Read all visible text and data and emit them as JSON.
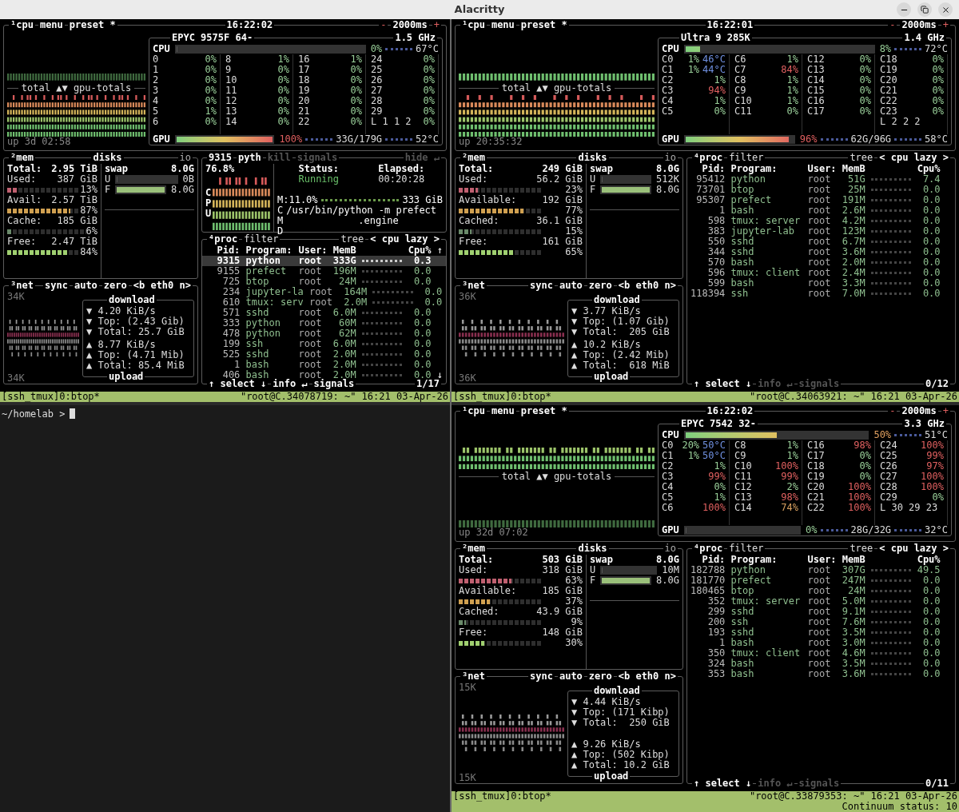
{
  "window": {
    "title": "Alacritty"
  },
  "panes": [
    {
      "cpu": {
        "tabs": [
          "¹cpu",
          "menu",
          "preset *"
        ],
        "time": "16:22:02",
        "minus": "-",
        "interval": "2000ms",
        "plus": "+",
        "model": "EPYC 9575F 64-",
        "freq": "1.5 GHz",
        "label": "CPU",
        "pct": "0%",
        "level": 0,
        "temp": "67°C",
        "graph_label": "total ▲▼ gpu-totals",
        "uptime": "up 3d 02:58",
        "gpu": {
          "label": "GPU",
          "pct": "100%",
          "level": 1,
          "mem": "33G/179G",
          "temp": "52°C"
        },
        "core_columns": [
          [
            {
              "label": "0",
              "pct": "0%",
              "color": "#9ad09a"
            },
            {
              "label": "1",
              "pct": "0%",
              "color": "#9ad09a"
            },
            {
              "label": "2",
              "pct": "0%",
              "color": "#9ad09a"
            },
            {
              "label": "3",
              "pct": "0%",
              "color": "#9ad09a"
            },
            {
              "label": "4",
              "pct": "0%",
              "color": "#9ad09a"
            },
            {
              "label": "5",
              "pct": "1%",
              "color": "#9ad09a"
            },
            {
              "label": "6",
              "pct": "0%",
              "color": "#9ad09a"
            }
          ],
          [
            {
              "label": "8",
              "pct": "1%",
              "color": "#9ad09a"
            },
            {
              "label": "9",
              "pct": "0%",
              "color": "#9ad09a"
            },
            {
              "label": "10",
              "pct": "0%",
              "color": "#9ad09a"
            },
            {
              "label": "11",
              "pct": "0%",
              "color": "#9ad09a"
            },
            {
              "label": "12",
              "pct": "0%",
              "color": "#9ad09a"
            },
            {
              "label": "13",
              "pct": "0%",
              "color": "#9ad09a"
            },
            {
              "label": "14",
              "pct": "0%",
              "color": "#9ad09a"
            }
          ],
          [
            {
              "label": "16",
              "pct": "1%",
              "color": "#9ad09a"
            },
            {
              "label": "17",
              "pct": "0%",
              "color": "#9ad09a"
            },
            {
              "label": "18",
              "pct": "0%",
              "color": "#9ad09a"
            },
            {
              "label": "19",
              "pct": "0%",
              "color": "#9ad09a"
            },
            {
              "label": "20",
              "pct": "0%",
              "color": "#9ad09a"
            },
            {
              "label": "21",
              "pct": "0%",
              "color": "#9ad09a"
            },
            {
              "label": "22",
              "pct": "0%",
              "color": "#9ad09a"
            }
          ],
          [
            {
              "label": "24",
              "pct": "0%",
              "color": "#9ad09a"
            },
            {
              "label": "25",
              "pct": "0%",
              "color": "#9ad09a"
            },
            {
              "label": "26",
              "pct": "0%",
              "color": "#9ad09a"
            },
            {
              "label": "27",
              "pct": "0%",
              "color": "#9ad09a"
            },
            {
              "label": "28",
              "pct": "0%",
              "color": "#9ad09a"
            },
            {
              "label": "29",
              "pct": "0%",
              "color": "#9ad09a"
            },
            {
              "label": "L 1 1 2",
              "pct": "0%",
              "color": "#9ad09a"
            }
          ]
        ]
      },
      "mem": {
        "title": "²mem",
        "total_label": "Total:",
        "total": "2.95 TiB",
        "rows": [
          {
            "kind": "used",
            "label": "Used:",
            "value": "387 GiB",
            "pct": "13%",
            "level": 0.13
          },
          {
            "kind": "available",
            "label": "Avail:",
            "value": "2.57 TiB",
            "pct": "87%",
            "level": 0.87
          },
          {
            "kind": "cached",
            "label": "Cache:",
            "value": "185 GiB",
            "pct": "6%",
            "level": 0.06
          },
          {
            "kind": "free",
            "label": "Free:",
            "value": "2.47 TiB",
            "pct": "84%",
            "level": 0.84
          }
        ],
        "disks": {
          "title": "disks",
          "io": "io",
          "swap_label": "swap",
          "swap": "8.0G",
          "bars": [
            {
              "label": "U",
              "value": "0B",
              "level": 0
            },
            {
              "label": "F",
              "value": "8.0G",
              "level": 1
            }
          ]
        }
      },
      "net": {
        "title": "³net",
        "buttons": [
          "sync",
          "auto",
          "zero",
          "<b eth0 n>"
        ],
        "scale_top": "34K",
        "scale_bottom": "34K",
        "download_label": "download",
        "upload_label": "upload",
        "download": [
          "▼ 4.20 KiB/s",
          "▼ Top: (2.43 Gib)",
          "▼ Total: 25.7 GiB"
        ],
        "upload": [
          "▲ 8.77 KiB/s",
          "▲ Top: (4.71 Mib)",
          "▲ Total: 85.4 MiB"
        ]
      },
      "detail": {
        "pid": "9315",
        "name": "pyth",
        "buttons": [
          "kill",
          "signals"
        ],
        "hide": "hide ↵",
        "cpu_pct": "76.8%",
        "cpu_letters": "CPU",
        "status_label": "Status:",
        "status": "Running",
        "elapsed_label": "Elapsed:",
        "elapsed": "00:20:28",
        "mem_pct": "M:11.0%",
        "mem": "333 GiB",
        "cmd_letters": "CMD",
        "cmd": "/usr/bin/python -m prefect",
        "cmd2": ".engine"
      },
      "proc": {
        "title": "⁴proc",
        "filter": "filter",
        "tree": "tree",
        "sort": "< cpu lazy >",
        "columns": [
          "Pid:",
          "Program:",
          "User:",
          "MemB",
          "Cpu%"
        ],
        "scroll_up": "↑",
        "scroll_down": "↓",
        "rows": [
          {
            "pid": "9315",
            "program": "python",
            "user": "root",
            "mem": "333G",
            "cpu": "0.3",
            "selected": true
          },
          {
            "pid": "9155",
            "program": "prefect",
            "user": "root",
            "mem": "196M",
            "cpu": "0.0",
            "selected": false
          },
          {
            "pid": "725",
            "program": "btop",
            "user": "root",
            "mem": "24M",
            "cpu": "0.0",
            "selected": false
          },
          {
            "pid": "234",
            "program": "jupyter-la",
            "user": "root",
            "mem": "164M",
            "cpu": "0.0",
            "selected": false
          },
          {
            "pid": "610",
            "program": "tmux: serv",
            "user": "root",
            "mem": "2.0M",
            "cpu": "0.0",
            "selected": false
          },
          {
            "pid": "571",
            "program": "sshd",
            "user": "root",
            "mem": "6.0M",
            "cpu": "0.0",
            "selected": false
          },
          {
            "pid": "333",
            "program": "python",
            "user": "root",
            "mem": "60M",
            "cpu": "0.0",
            "selected": false
          },
          {
            "pid": "478",
            "program": "python",
            "user": "root",
            "mem": "62M",
            "cpu": "0.0",
            "selected": false
          },
          {
            "pid": "199",
            "program": "ssh",
            "user": "root",
            "mem": "6.0M",
            "cpu": "0.0",
            "selected": false
          },
          {
            "pid": "525",
            "program": "sshd",
            "user": "root",
            "mem": "2.0M",
            "cpu": "0.0",
            "selected": false
          },
          {
            "pid": "1",
            "program": "bash",
            "user": "root",
            "mem": "2.0M",
            "cpu": "0.0",
            "selected": false
          },
          {
            "pid": "406",
            "program": "bash",
            "user": "root",
            "mem": "2.0M",
            "cpu": "0.0",
            "selected": false
          }
        ],
        "footer": [
          {
            "label": "↑ select ↓",
            "disabled": false
          },
          {
            "label": "info ↵",
            "disabled": false
          },
          {
            "label": "signals",
            "disabled": false
          }
        ],
        "count": "1/17"
      },
      "status": {
        "left": "[ssh_tmux]0:btop*",
        "right": "\"root@C.34078719: ~\" 16:21 03-Apr-26"
      }
    },
    {
      "cpu": {
        "tabs": [
          "¹cpu",
          "menu",
          "preset *"
        ],
        "time": "16:22:01",
        "minus": "-",
        "interval": "2000ms",
        "plus": "+",
        "model": "Ultra 9 285K",
        "freq": "1.4 GHz",
        "label": "CPU",
        "pct": "8%",
        "level": 0.08,
        "temp": "72°C",
        "graph_label": "total ▲▼ gpu-totals",
        "uptime": "up 20:35:32",
        "gpu": {
          "label": "GPU",
          "pct": "96%",
          "level": 0.96,
          "mem": "62G/96G",
          "temp": "58°C"
        },
        "core_columns": [
          [
            {
              "label": "C0",
              "pct": "1%",
              "temp": "46°C",
              "color": "#9ad09a"
            },
            {
              "label": "C1",
              "pct": "1%",
              "temp": "44°C",
              "color": "#9ad09a"
            },
            {
              "label": "C2",
              "pct": "1%",
              "color": "#9ad09a"
            },
            {
              "label": "C3",
              "pct": "94%",
              "color": "#e06060"
            },
            {
              "label": "C4",
              "pct": "1%",
              "color": "#9ad09a"
            },
            {
              "label": "C5",
              "pct": "0%",
              "color": "#9ad09a"
            }
          ],
          [
            {
              "label": "C6",
              "pct": "1%",
              "color": "#9ad09a"
            },
            {
              "label": "C7",
              "pct": "84%",
              "color": "#e06060"
            },
            {
              "label": "C8",
              "pct": "1%",
              "color": "#9ad09a"
            },
            {
              "label": "C9",
              "pct": "1%",
              "color": "#9ad09a"
            },
            {
              "label": "C10",
              "pct": "1%",
              "color": "#9ad09a"
            },
            {
              "label": "C11",
              "pct": "0%",
              "color": "#9ad09a"
            }
          ],
          [
            {
              "label": "C12",
              "pct": "0%",
              "color": "#9ad09a"
            },
            {
              "label": "C13",
              "pct": "0%",
              "color": "#9ad09a"
            },
            {
              "label": "C14",
              "pct": "0%",
              "color": "#9ad09a"
            },
            {
              "label": "C15",
              "pct": "0%",
              "color": "#9ad09a"
            },
            {
              "label": "C16",
              "pct": "0%",
              "color": "#9ad09a"
            },
            {
              "label": "C17",
              "pct": "0%",
              "color": "#9ad09a"
            }
          ],
          [
            {
              "label": "C18",
              "pct": "0%",
              "color": "#9ad09a"
            },
            {
              "label": "C19",
              "pct": "0%",
              "color": "#9ad09a"
            },
            {
              "label": "C20",
              "pct": "0%",
              "color": "#9ad09a"
            },
            {
              "label": "C21",
              "pct": "0%",
              "color": "#9ad09a"
            },
            {
              "label": "C22",
              "pct": "0%",
              "color": "#9ad09a"
            },
            {
              "label": "C23",
              "pct": "0%",
              "color": "#9ad09a"
            },
            {
              "label": "L 2 2 2",
              "color": "#dddddd"
            }
          ]
        ]
      },
      "mem": {
        "title": "²mem",
        "total_label": "Total:",
        "total": "249 GiB",
        "rows": [
          {
            "kind": "used",
            "label": "Used:",
            "value": "56.2 GiB",
            "pct": "23%",
            "level": 0.23
          },
          {
            "kind": "available",
            "label": "Available:",
            "value": "192 GiB",
            "pct": "77%",
            "level": 0.77
          },
          {
            "kind": "cached",
            "label": "Cached:",
            "value": "36.1 GiB",
            "pct": "15%",
            "level": 0.15
          },
          {
            "kind": "free",
            "label": "Free:",
            "value": "161 GiB",
            "pct": "65%",
            "level": 0.65
          }
        ],
        "disks": {
          "title": "disks",
          "io": "io",
          "swap_label": "swap",
          "swap": "8.0G",
          "bars": [
            {
              "label": "U",
              "value": "512K",
              "level": 0
            },
            {
              "label": "F",
              "value": "8.0G",
              "level": 1
            }
          ]
        }
      },
      "net": {
        "title": "³net",
        "buttons": [
          "sync",
          "auto",
          "zero",
          "<b eth0 n>"
        ],
        "scale_top": "36K",
        "scale_bottom": "36K",
        "download_label": "download",
        "upload_label": "upload",
        "download": [
          "▼ 3.77 KiB/s",
          "▼ Top: (1.07 Gib)",
          "▼ Total:  205 GiB"
        ],
        "upload": [
          "▲ 10.2 KiB/s",
          "▲ Top: (2.42 Mib)",
          "▲ Total:  618 MiB"
        ]
      },
      "proc": {
        "title": "⁴proc",
        "filter": "filter",
        "tree": "tree",
        "sort": "< cpu lazy >",
        "columns": [
          "Pid:",
          "Program:",
          "User:",
          "MemB",
          "Cpu%"
        ],
        "rows": [
          {
            "pid": "95412",
            "program": "python",
            "user": "root",
            "mem": "51G",
            "cpu": "7.4",
            "selected": false
          },
          {
            "pid": "73701",
            "program": "btop",
            "user": "root",
            "mem": "25M",
            "cpu": "0.0",
            "selected": false
          },
          {
            "pid": "95307",
            "program": "prefect",
            "user": "root",
            "mem": "191M",
            "cpu": "0.0",
            "selected": false
          },
          {
            "pid": "1",
            "program": "bash",
            "user": "root",
            "mem": "2.6M",
            "cpu": "0.0",
            "selected": false
          },
          {
            "pid": "598",
            "program": "tmux: server",
            "user": "root",
            "mem": "4.2M",
            "cpu": "0.0",
            "selected": false
          },
          {
            "pid": "383",
            "program": "jupyter-lab",
            "user": "root",
            "mem": "123M",
            "cpu": "0.0",
            "selected": false
          },
          {
            "pid": "550",
            "program": "sshd",
            "user": "root",
            "mem": "6.7M",
            "cpu": "0.0",
            "selected": false
          },
          {
            "pid": "344",
            "program": "sshd",
            "user": "root",
            "mem": "3.6M",
            "cpu": "0.0",
            "selected": false
          },
          {
            "pid": "570",
            "program": "bash",
            "user": "root",
            "mem": "2.0M",
            "cpu": "0.0",
            "selected": false
          },
          {
            "pid": "596",
            "program": "tmux: client",
            "user": "root",
            "mem": "2.4M",
            "cpu": "0.0",
            "selected": false
          },
          {
            "pid": "599",
            "program": "bash",
            "user": "root",
            "mem": "3.3M",
            "cpu": "0.0",
            "selected": false
          },
          {
            "pid": "118394",
            "program": "ssh",
            "user": "root",
            "mem": "7.0M",
            "cpu": "0.0",
            "selected": false
          }
        ],
        "footer": [
          {
            "label": "↑ select ↓",
            "disabled": false
          },
          {
            "label": "info ↵",
            "disabled": true
          },
          {
            "label": "signals",
            "disabled": true
          }
        ],
        "count": "0/12"
      },
      "status": {
        "left": "[ssh_tmux]0:btop*",
        "right": "\"root@C.34063921: ~\" 16:21 03-Apr-26"
      }
    },
    {
      "cpu": {
        "tabs": [
          "¹cpu",
          "menu",
          "preset *"
        ],
        "time": "16:22:02",
        "minus": "-",
        "interval": "2000ms",
        "plus": "+",
        "model": "EPYC 7542 32-",
        "freq": "3.3 GHz",
        "label": "CPU",
        "pct": "50%",
        "level": 0.5,
        "temp": "51°C",
        "graph_label": "total ▲▼ gpu-totals",
        "uptime": "up 32d 07:02",
        "gpu": {
          "label": "GPU",
          "pct": "0%",
          "level": 0,
          "mem": "28G/32G",
          "temp": "32°C"
        },
        "core_columns": [
          [
            {
              "label": "C0",
              "pct": "20%",
              "temp": "50°C",
              "color": "#9ad09a"
            },
            {
              "label": "C1",
              "pct": "1%",
              "temp": "50°C",
              "color": "#9ad09a"
            },
            {
              "label": "C2",
              "pct": "1%",
              "color": "#9ad09a"
            },
            {
              "label": "C3",
              "pct": "99%",
              "color": "#e06060"
            },
            {
              "label": "C4",
              "pct": "0%",
              "color": "#9ad09a"
            },
            {
              "label": "C5",
              "pct": "1%",
              "color": "#9ad09a"
            },
            {
              "label": "C6",
              "pct": "100%",
              "color": "#e06060"
            }
          ],
          [
            {
              "label": "C8",
              "pct": "1%",
              "color": "#9ad09a"
            },
            {
              "label": "C9",
              "pct": "1%",
              "color": "#9ad09a"
            },
            {
              "label": "C10",
              "pct": "100%",
              "color": "#e06060"
            },
            {
              "label": "C11",
              "pct": "99%",
              "color": "#e06060"
            },
            {
              "label": "C12",
              "pct": "2%",
              "color": "#9ad09a"
            },
            {
              "label": "C13",
              "pct": "98%",
              "color": "#e06060"
            },
            {
              "label": "C14",
              "pct": "74%",
              "color": "#d9a060"
            }
          ],
          [
            {
              "label": "C16",
              "pct": "98%",
              "color": "#e06060"
            },
            {
              "label": "C17",
              "pct": "0%",
              "color": "#9ad09a"
            },
            {
              "label": "C18",
              "pct": "0%",
              "color": "#9ad09a"
            },
            {
              "label": "C19",
              "pct": "0%",
              "color": "#9ad09a"
            },
            {
              "label": "C20",
              "pct": "100%",
              "color": "#e06060"
            },
            {
              "label": "C21",
              "pct": "100%",
              "color": "#e06060"
            },
            {
              "label": "C22",
              "pct": "100%",
              "color": "#e06060"
            }
          ],
          [
            {
              "label": "C24",
              "pct": "100%",
              "color": "#e06060"
            },
            {
              "label": "C25",
              "pct": "99%",
              "color": "#e06060"
            },
            {
              "label": "C26",
              "pct": "97%",
              "color": "#e06060"
            },
            {
              "label": "C27",
              "pct": "100%",
              "color": "#e06060"
            },
            {
              "label": "C28",
              "pct": "100%",
              "color": "#e06060"
            },
            {
              "label": "C29",
              "pct": "0%",
              "color": "#9ad09a"
            },
            {
              "label": "L 30 29 23",
              "color": "#dddddd"
            }
          ]
        ]
      },
      "mem": {
        "title": "²mem",
        "total_label": "Total:",
        "total": "503 GiB",
        "rows": [
          {
            "kind": "used",
            "label": "Used:",
            "value": "318 GiB",
            "pct": "63%",
            "level": 0.63
          },
          {
            "kind": "available",
            "label": "Available:",
            "value": "185 GiB",
            "pct": "37%",
            "level": 0.37
          },
          {
            "kind": "cached",
            "label": "Cached:",
            "value": "43.9 GiB",
            "pct": "9%",
            "level": 0.09
          },
          {
            "kind": "free",
            "label": "Free:",
            "value": "148 GiB",
            "pct": "30%",
            "level": 0.3
          }
        ],
        "disks": {
          "title": "disks",
          "io": "io",
          "swap_label": "swap",
          "swap": "8.0G",
          "bars": [
            {
              "label": "U",
              "value": "10M",
              "level": 0
            },
            {
              "label": "F",
              "value": "8.0G",
              "level": 1
            }
          ]
        }
      },
      "net": {
        "title": "³net",
        "buttons": [
          "sync",
          "auto",
          "zero",
          "<b eth0 n>"
        ],
        "scale_top": "15K",
        "scale_bottom": "15K",
        "download_label": "download",
        "upload_label": "upload",
        "download": [
          "▼ 4.44 KiB/s",
          "▼ Top: (171 Kibp)",
          "▼ Total:  250 GiB"
        ],
        "upload": [
          "▲ 9.26 KiB/s",
          "▲ Top: (502 Kibp)",
          "▲ Total: 10.2 GiB"
        ]
      },
      "proc": {
        "title": "⁴proc",
        "filter": "filter",
        "tree": "tree",
        "sort": "< cpu lazy >",
        "columns": [
          "Pid:",
          "Program:",
          "User:",
          "MemB",
          "Cpu%"
        ],
        "rows": [
          {
            "pid": "182788",
            "program": "python",
            "user": "root",
            "mem": "307G",
            "cpu": "49.5",
            "selected": false
          },
          {
            "pid": "181770",
            "program": "prefect",
            "user": "root",
            "mem": "247M",
            "cpu": "0.0",
            "selected": false
          },
          {
            "pid": "180465",
            "program": "btop",
            "user": "root",
            "mem": "24M",
            "cpu": "0.0",
            "selected": false
          },
          {
            "pid": "352",
            "program": "tmux: server",
            "user": "root",
            "mem": "5.0M",
            "cpu": "0.0",
            "selected": false
          },
          {
            "pid": "299",
            "program": "sshd",
            "user": "root",
            "mem": "9.1M",
            "cpu": "0.0",
            "selected": false
          },
          {
            "pid": "200",
            "program": "ssh",
            "user": "root",
            "mem": "7.6M",
            "cpu": "0.0",
            "selected": false
          },
          {
            "pid": "193",
            "program": "sshd",
            "user": "root",
            "mem": "3.5M",
            "cpu": "0.0",
            "selected": false
          },
          {
            "pid": "1",
            "program": "bash",
            "user": "root",
            "mem": "3.0M",
            "cpu": "0.0",
            "selected": false
          },
          {
            "pid": "350",
            "program": "tmux: client",
            "user": "root",
            "mem": "4.6M",
            "cpu": "0.0",
            "selected": false
          },
          {
            "pid": "324",
            "program": "bash",
            "user": "root",
            "mem": "3.5M",
            "cpu": "0.0",
            "selected": false
          },
          {
            "pid": "353",
            "program": "bash",
            "user": "root",
            "mem": "3.6M",
            "cpu": "0.0",
            "selected": false
          }
        ],
        "footer": [
          {
            "label": "↑ select ↓",
            "disabled": false
          },
          {
            "label": "info ↵",
            "disabled": true
          },
          {
            "label": "signals",
            "disabled": true
          }
        ],
        "count": "0/11"
      },
      "status": {
        "left": "[ssh_tmux]0:btop*",
        "right": "\"root@C.33879353: ~\" 16:21 03-Apr-26",
        "extra": "Continuum status: 10"
      }
    }
  ],
  "terminal": {
    "prompt": "~/homelab >"
  }
}
